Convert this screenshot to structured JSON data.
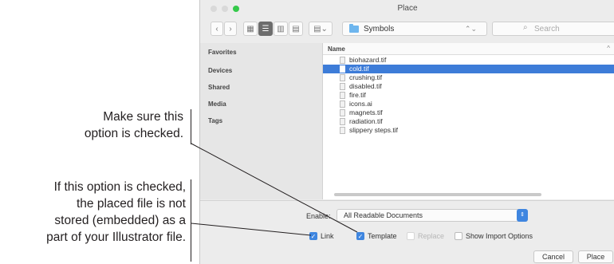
{
  "callouts": {
    "first": {
      "line1": "Make sure this",
      "line2": "option is checked."
    },
    "second": {
      "line1": "If this option is checked,",
      "line2": "the placed file is not",
      "line3": "stored (embedded) as a",
      "line4": "part of your Illustrator file."
    }
  },
  "window": {
    "title": "Place"
  },
  "toolbar": {
    "back_icon": "chevron-left-icon",
    "forward_icon": "chevron-right-icon",
    "view_icons": [
      "icon-view-icon",
      "list-view-icon",
      "column-view-icon",
      "cover-flow-icon"
    ],
    "arrange_icon": "arrange-icon",
    "location": "Symbols",
    "search_placeholder": "Search"
  },
  "sidebar": {
    "items": [
      "Favorites",
      "Devices",
      "Shared",
      "Media",
      "Tags"
    ]
  },
  "file_list": {
    "column_header": "Name",
    "files": [
      {
        "name": "biohazard.tif",
        "selected": false
      },
      {
        "name": "cold.tif",
        "selected": true
      },
      {
        "name": "crushing.tif",
        "selected": false
      },
      {
        "name": "disabled.tif",
        "selected": false
      },
      {
        "name": "fire.tif",
        "selected": false
      },
      {
        "name": "icons.ai",
        "selected": false
      },
      {
        "name": "magnets.tif",
        "selected": false
      },
      {
        "name": "radiation.tif",
        "selected": false
      },
      {
        "name": "slippery steps.tif",
        "selected": false
      }
    ]
  },
  "options": {
    "enable_label": "Enable:",
    "enable_value": "All Readable Documents",
    "link": {
      "label": "Link",
      "checked": true
    },
    "template": {
      "label": "Template",
      "checked": true
    },
    "replace": {
      "label": "Replace",
      "checked": false,
      "disabled": true
    },
    "show_import_options": {
      "label": "Show Import Options",
      "checked": false
    }
  },
  "buttons": {
    "cancel": "Cancel",
    "place": "Place"
  },
  "colors": {
    "selection": "#3d7cd8",
    "checkbox_checked": "#3f86e0",
    "zoom_button": "#35c94a"
  }
}
